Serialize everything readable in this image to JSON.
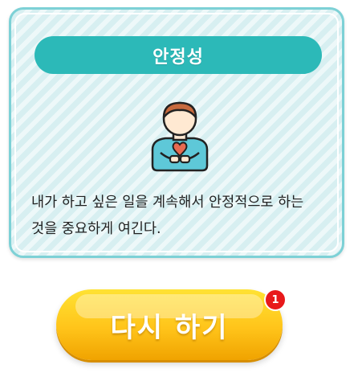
{
  "card": {
    "title": "안정성",
    "icon": "person-holding-heart-icon",
    "description": "내가 하고 싶은 일을 계속해서 안정적으로 하는 것을 중요하게 여긴다."
  },
  "retry_button": {
    "label": "다시 하기",
    "badge_count": "1"
  },
  "colors": {
    "card_border": "#7dd1d6",
    "card_bg": "#d7eff1",
    "title_bar": "#2cb9b8",
    "button_yellow": "#ffc41a",
    "badge_red": "#e8191b",
    "heart": "#e86a50"
  }
}
